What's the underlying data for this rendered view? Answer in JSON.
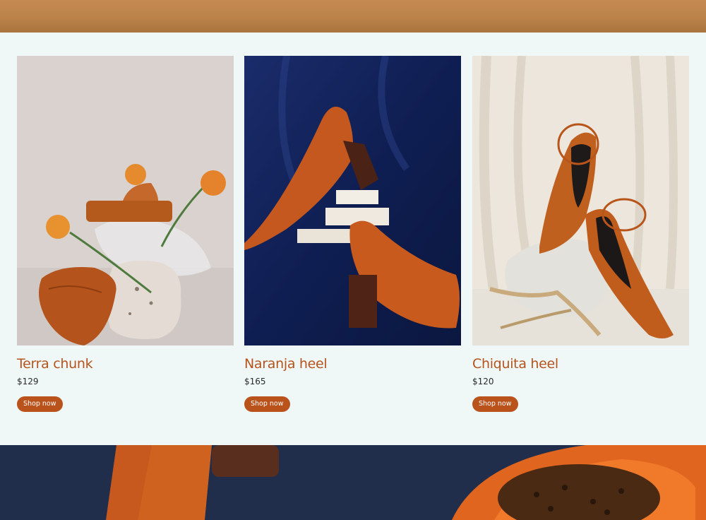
{
  "products": [
    {
      "name": "Terra chunk",
      "price": "$129",
      "cta": "Shop now"
    },
    {
      "name": "Naranja heel",
      "price": "$165",
      "cta": "Shop now"
    },
    {
      "name": "Chiquita heel",
      "price": "$120",
      "cta": "Shop now"
    }
  ],
  "colors": {
    "accent": "#b9521b",
    "name_text": "#b5541d",
    "section_bg": "#eff7f7"
  }
}
